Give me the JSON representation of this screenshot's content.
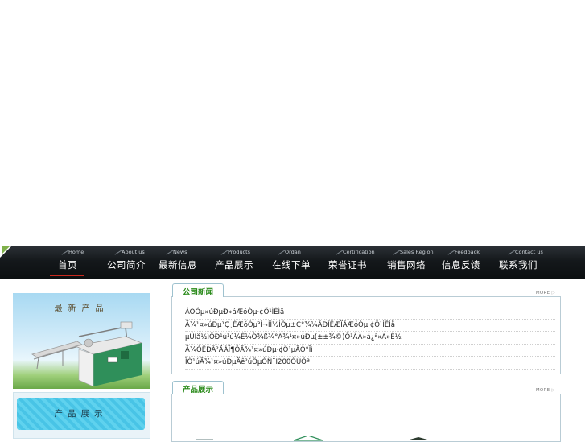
{
  "nav": {
    "items": [
      {
        "en": "Home",
        "cn": "首页"
      },
      {
        "en": "About us",
        "cn": "公司简介"
      },
      {
        "en": "News",
        "cn": "最新信息"
      },
      {
        "en": "Products",
        "cn": "产品展示"
      },
      {
        "en": "Ordan",
        "cn": "在线下单"
      },
      {
        "en": "Certification",
        "cn": "荣誉证书"
      },
      {
        "en": "Sales  Region",
        "cn": "销售网络"
      },
      {
        "en": "Feedback",
        "cn": "信息反馈"
      },
      {
        "en": "Contact us",
        "cn": "联系我们"
      }
    ]
  },
  "sidebar": {
    "promo_title": "最新产品",
    "tab_label": "产品展示"
  },
  "news": {
    "title": "公司新闻",
    "more": "MORE",
    "items": [
      "ÁÒÓµ»úÐµÐ»áÆóÒµ·¢Õ¹ÌÊÌå",
      "Ä¾¹¤»úÐµ¹Ç¸ÉÆóÒµ³Í¬ÍÌ½ÍÒµ±Ç°¾¼ÃÐÎÊÆÏÂÆóÒµ·¢Õ¹ÌÊÌå",
      "µÚÍå½ìÖÐ¹ú¹ú¼Ê¼Ò¾ß¾°Ä¾¹¤»úÐµ(±±¾©)Õ¹ÀÀ»á¿ª»Ä»Ê½",
      "Ä¾ÒÊÐÂ²ÄÁÏ¶ÔÄ¾¹¤»úÐµ·¢Õ¹µÄÓ°Ïì",
      "ÎÒ¹úÄ¾¹¤»úÐµÄê²úÖµÓÑ¨I200ÓÚÔª"
    ]
  },
  "products": {
    "title": "产品展示",
    "more": "MORE"
  }
}
